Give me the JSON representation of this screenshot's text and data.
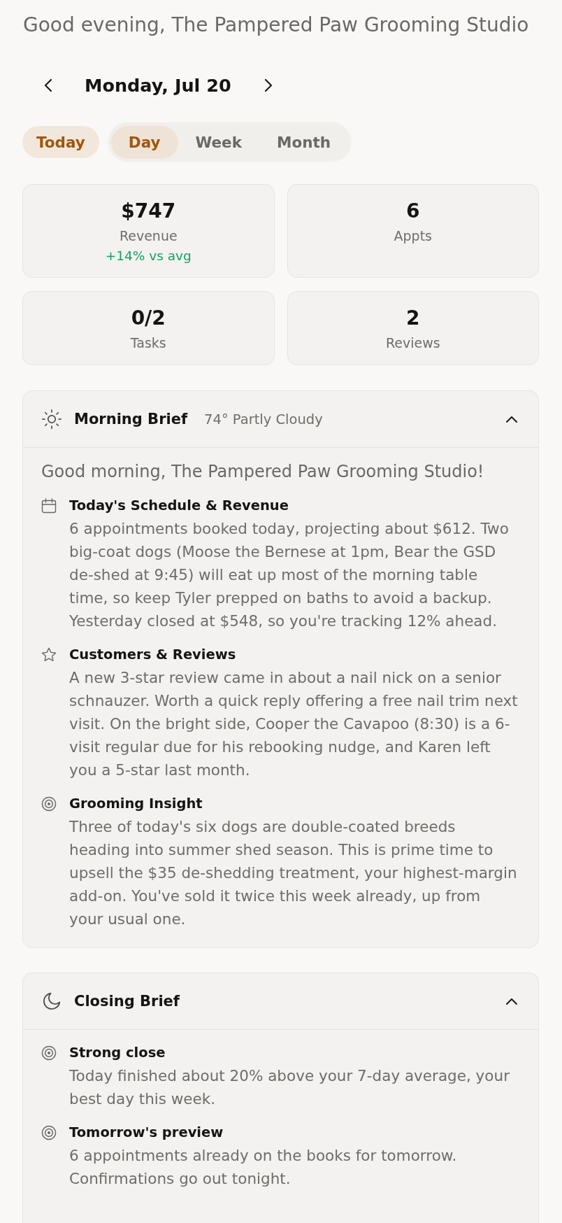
{
  "greeting": "Good evening, The Pampered Paw Grooming Studio",
  "date_nav": {
    "title": "Monday, Jul 20"
  },
  "today_button": {
    "label": "Today"
  },
  "view_tabs": [
    {
      "label": "Day",
      "selected": true
    },
    {
      "label": "Week",
      "selected": false
    },
    {
      "label": "Month",
      "selected": false
    }
  ],
  "stats": [
    {
      "value": "$747",
      "label": "Revenue",
      "delta": "+14% vs avg"
    },
    {
      "value": "6",
      "label": "Appts"
    },
    {
      "value": "0/2",
      "label": "Tasks"
    },
    {
      "value": "2",
      "label": "Reviews"
    }
  ],
  "briefs": [
    {
      "kind": "morning",
      "title": "Morning Brief",
      "weather": "74° Partly Cloudy",
      "expanded": true,
      "intro": "Good morning, The Pampered Paw Grooming Studio!",
      "sections": [
        {
          "kind": "schedule",
          "title": "Today's Schedule & Revenue",
          "text": "6 appointments booked today, projecting about $612. Two big-coat dogs (Moose the Bernese at 1pm, Bear the GSD de-shed at 9:45) will eat up most of the morning table time, so keep Tyler prepped on baths to avoid a backup. Yesterday closed at $548, so you're tracking 12% ahead."
        },
        {
          "kind": "reviews",
          "title": "Customers & Reviews",
          "text": "A new 3-star review came in about a nail nick on a senior schnauzer. Worth a quick reply offering a free nail trim next visit. On the bright side, Cooper the Cavapoo (8:30) is a 6-visit regular due for his rebooking nudge, and Karen left you a 5-star last month."
        },
        {
          "kind": "insight",
          "title": "Grooming Insight",
          "text": "Three of today's six dogs are double-coated breeds heading into summer shed season. This is prime time to upsell the $35 de-shedding treatment, your highest-margin add-on. You've sold it twice this week already, up from your usual one."
        }
      ]
    },
    {
      "kind": "closing",
      "title": "Closing Brief",
      "expanded": true,
      "sections": [
        {
          "kind": "insight",
          "title": "Strong close",
          "text": "Today finished about 20% above your 7-day average, your best day this week."
        },
        {
          "kind": "insight",
          "title": "Tomorrow's preview",
          "text": "6 appointments already on the books for tomorrow. Confirmations go out tonight."
        }
      ]
    }
  ]
}
